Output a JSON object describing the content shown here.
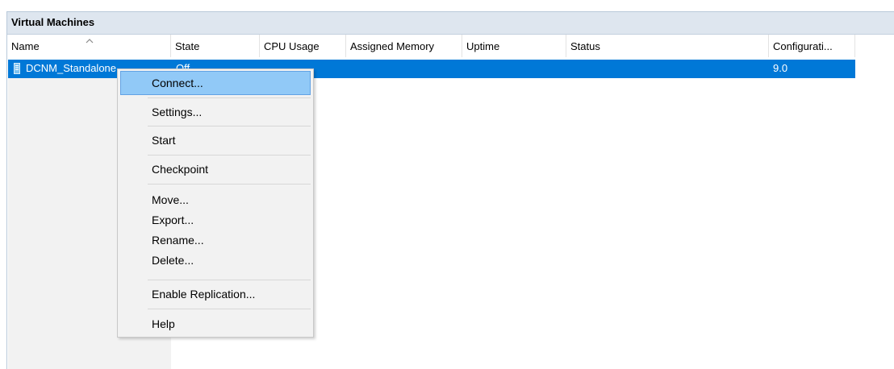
{
  "panel": {
    "title": "Virtual Machines"
  },
  "columns": [
    "Name",
    "State",
    "CPU Usage",
    "Assigned Memory",
    "Uptime",
    "Status",
    "Configurati..."
  ],
  "selected_row": {
    "name": "DCNM_Standalone",
    "state": "Off",
    "cpu_usage": "",
    "assigned_memory": "",
    "uptime": "",
    "status": "",
    "configuration": "9.0"
  },
  "context_menu": {
    "items": [
      "Connect...",
      "Settings...",
      "Start",
      "Checkpoint",
      "Move...",
      "Export...",
      "Rename...",
      "Delete...",
      "Enable Replication...",
      "Help"
    ],
    "highlighted_index": 0
  },
  "colors": {
    "selection": "#0078d7",
    "menu_highlight": "#91c9f7",
    "header_background": "#dee6ef"
  },
  "icons": {
    "sort": "chevron-up-icon",
    "vm": "virtual-machine-icon"
  }
}
